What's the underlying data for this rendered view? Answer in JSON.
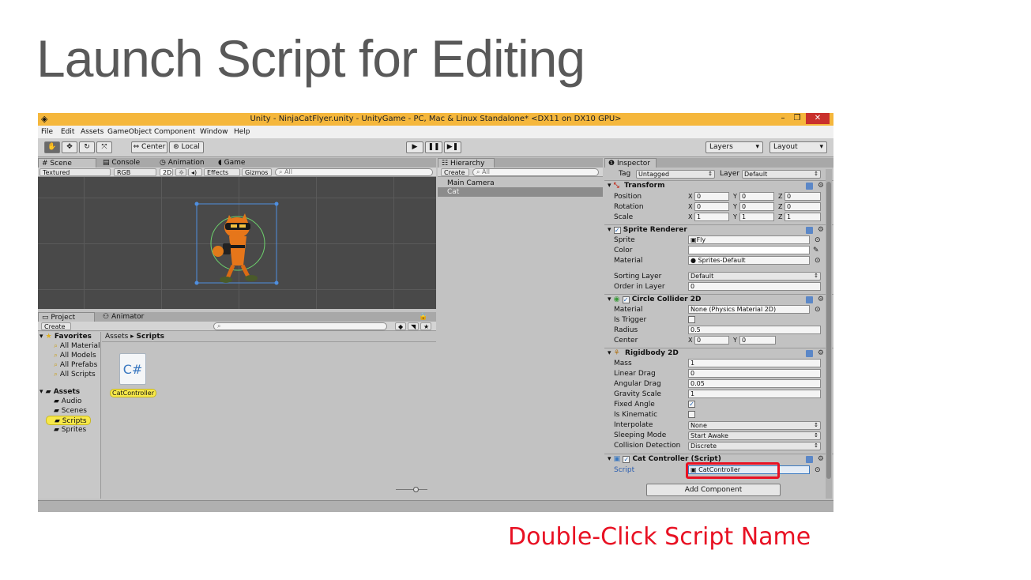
{
  "slide": {
    "title": "Launch Script for Editing",
    "caption": "Double-Click Script Name"
  },
  "window": {
    "title": "Unity - NinjaCatFlyer.unity - UnityGame - PC, Mac & Linux Standalone* <DX11 on DX10 GPU>",
    "logo_icon": "unity-logo-icon",
    "min": "–",
    "max": "❐",
    "close": "✕"
  },
  "menu": [
    "File",
    "Edit",
    "Assets",
    "GameObject",
    "Component",
    "Window",
    "Help"
  ],
  "toolbar": {
    "tools": [
      "hand-tool-icon",
      "move-tool-icon",
      "rotate-tool-icon",
      "scale-tool-icon"
    ],
    "tool_glyphs": [
      "✋",
      "✥",
      "↻",
      "⤧"
    ],
    "pivot": "Center",
    "space": "Local",
    "play": "▶",
    "pause": "❚❚",
    "step": "▶❚",
    "layers": "Layers",
    "layout": "Layout"
  },
  "scene_panel": {
    "tabs": [
      "Scene",
      "Console",
      "Animation",
      "Game"
    ],
    "shading": "Textured",
    "render_mode": "RGB",
    "mode_2d": "2D",
    "effects": "Effects",
    "gizmos": "Gizmos",
    "search_placeholder": "All"
  },
  "hierarchy": {
    "tab": "Hierarchy",
    "create": "Create",
    "search_placeholder": "All",
    "items": [
      "Main Camera",
      "Cat"
    ],
    "selected": "Cat"
  },
  "project": {
    "tabs": [
      "Project",
      "Animator"
    ],
    "create": "Create",
    "breadcrumb": [
      "Assets",
      "Scripts"
    ],
    "favorites": {
      "label": "Favorites",
      "items": [
        "All Material",
        "All Models",
        "All Prefabs",
        "All Scripts"
      ]
    },
    "assets": {
      "label": "Assets",
      "items": [
        "Audio",
        "Scenes",
        "Scripts",
        "Sprites"
      ],
      "selected": "Scripts"
    },
    "file": {
      "name": "CatController",
      "glyph": "C#"
    }
  },
  "inspector": {
    "tab": "Inspector",
    "tag_label": "Tag",
    "tag": "Untagged",
    "layer_label": "Layer",
    "layer": "Default",
    "transform": {
      "title": "Transform",
      "rows": [
        {
          "label": "Position",
          "x": "0",
          "y": "0",
          "z": "0"
        },
        {
          "label": "Rotation",
          "x": "0",
          "y": "0",
          "z": "0"
        },
        {
          "label": "Scale",
          "x": "1",
          "y": "1",
          "z": "1"
        }
      ]
    },
    "sprite_renderer": {
      "title": "Sprite Renderer",
      "sprite_label": "Sprite",
      "sprite": "Fly",
      "color_label": "Color",
      "material_label": "Material",
      "material": "Sprites-Default",
      "sorting_layer_label": "Sorting Layer",
      "sorting_layer": "Default",
      "order_label": "Order in Layer",
      "order": "0"
    },
    "circle_collider": {
      "title": "Circle Collider 2D",
      "material_label": "Material",
      "material": "None (Physics Material 2D)",
      "trigger_label": "Is Trigger",
      "radius_label": "Radius",
      "radius": "0.5",
      "center_label": "Center",
      "center_x": "0",
      "center_y": "0"
    },
    "rigidbody": {
      "title": "Rigidbody 2D",
      "mass_label": "Mass",
      "mass": "1",
      "linear_drag_label": "Linear Drag",
      "linear_drag": "0",
      "angular_drag_label": "Angular Drag",
      "angular_drag": "0.05",
      "gravity_label": "Gravity Scale",
      "gravity": "1",
      "fixed_angle_label": "Fixed Angle",
      "fixed_angle": true,
      "kinematic_label": "Is Kinematic",
      "kinematic": false,
      "interpolate_label": "Interpolate",
      "interpolate": "None",
      "sleeping_label": "Sleeping Mode",
      "sleeping": "Start Awake",
      "collision_label": "Collision Detection",
      "collision": "Discrete"
    },
    "cat_controller": {
      "title": "Cat Controller (Script)",
      "script_label": "Script",
      "script": "CatController"
    },
    "add_component": "Add Component"
  },
  "colors": {
    "highlight": "#e81123",
    "selection": "#f7e84a",
    "title_gray": "#595959",
    "unity_bar": "#f5b73c"
  }
}
